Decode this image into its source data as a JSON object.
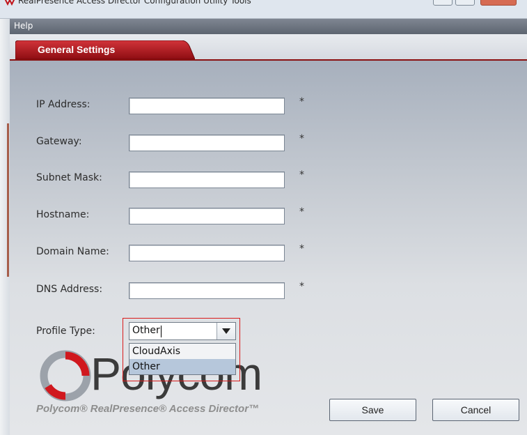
{
  "window": {
    "title": "RealPresence Access Director Configuration Utility Tools"
  },
  "menu": {
    "help_label": "Help"
  },
  "tabs": [
    {
      "label": "General Settings",
      "active": true
    }
  ],
  "form": {
    "fields": [
      {
        "label": "IP Address:",
        "value": "",
        "required_marker": "*"
      },
      {
        "label": "Gateway:",
        "value": "",
        "required_marker": "*"
      },
      {
        "label": "Subnet Mask:",
        "value": "",
        "required_marker": "*"
      },
      {
        "label": "Hostname:",
        "value": "",
        "required_marker": "*"
      },
      {
        "label": "Domain Name:",
        "value": "",
        "required_marker": "*"
      },
      {
        "label": "DNS Address:",
        "value": "",
        "required_marker": "*"
      }
    ],
    "profile_type": {
      "label": "Profile Type:",
      "selected": "Other",
      "options": [
        "CloudAxis",
        "Other"
      ]
    }
  },
  "branding": {
    "logo_text": "Polycom",
    "tagline": "Polycom® RealPresence® Access Director™",
    "logo_color": "#d0181e"
  },
  "buttons": {
    "save_label": "Save",
    "cancel_label": "Cancel"
  },
  "colors": {
    "accent": "#b5121b",
    "highlight_border": "#d91a1a",
    "selected_option": "#b6c7db"
  }
}
